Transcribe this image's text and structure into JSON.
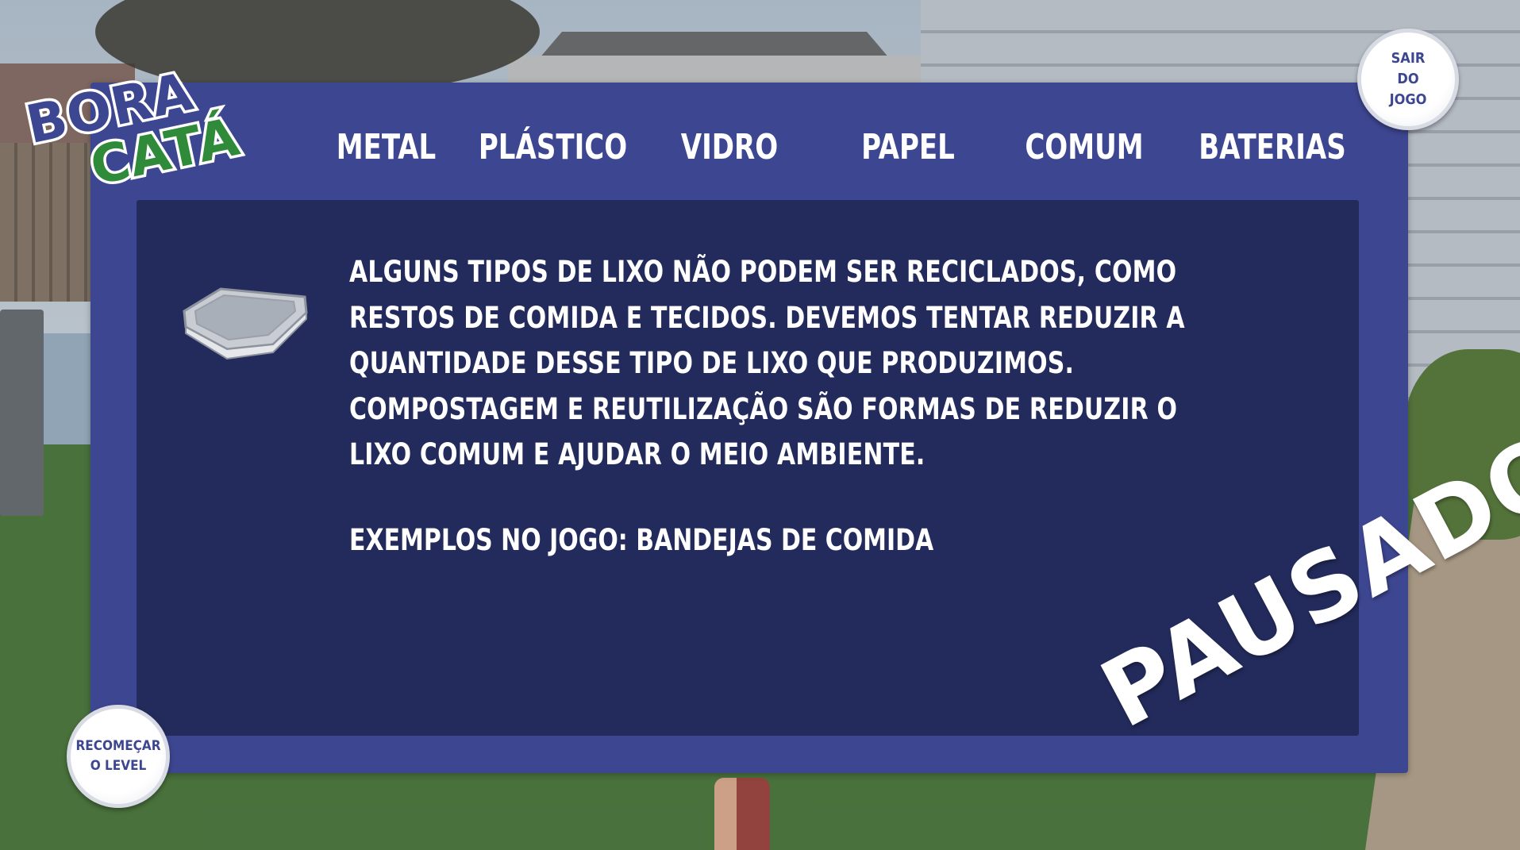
{
  "logo": {
    "line1": "BORA",
    "line2": "CATÁ",
    "colors": {
      "blue": "#3d4690",
      "green": "#2f8a3a",
      "outline": "#ffffff"
    }
  },
  "tabs": [
    {
      "label": "METAL"
    },
    {
      "label": "PLÁSTICO"
    },
    {
      "label": "VIDRO"
    },
    {
      "label": "PAPEL"
    },
    {
      "label": "COMUM"
    },
    {
      "label": "BATERIAS"
    }
  ],
  "info": {
    "description": "Alguns tipos de lixo não podem ser reciclados, como restos de comida e tecidos. Devemos tentar reduzir a quantidade desse tipo de lixo que produzimos. Compostagem e reutilização são formas de reduzir o lixo comum e ajudar o meio ambiente.",
    "examples": "Exemplos no jogo: bandejas de comida",
    "item_icon": "food-tray-icon"
  },
  "buttons": {
    "exit": "SAIR\nDO\nJOGO",
    "restart": "RECOMEÇAR\nO LEVEL"
  },
  "status": "PAUSADO",
  "colors": {
    "panel": "#3d4690",
    "content": "#232b5c",
    "text": "#ffffff"
  }
}
